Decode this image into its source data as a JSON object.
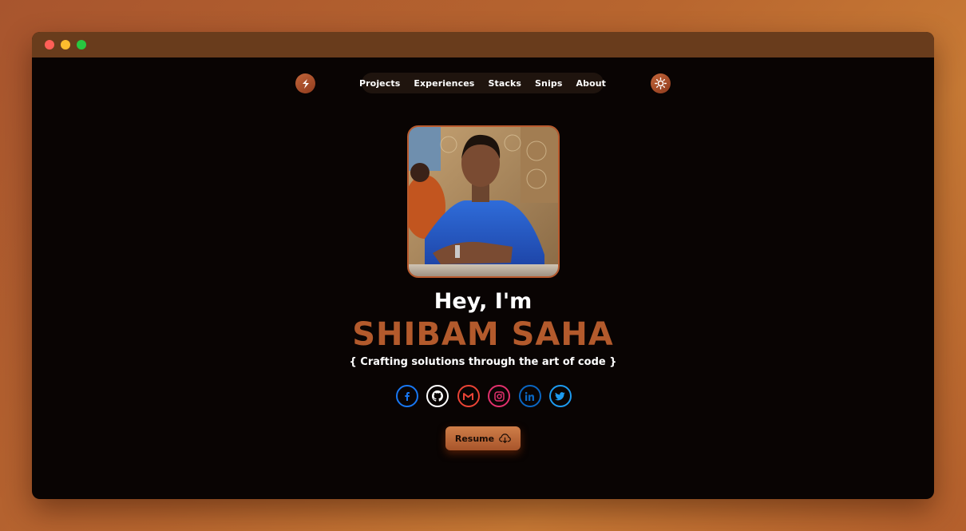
{
  "nav": {
    "items": [
      "Projects",
      "Experiences",
      "Stacks",
      "Snips",
      "About"
    ]
  },
  "hero": {
    "greeting": "Hey, I'm",
    "name": "SHIBAM SAHA",
    "tagline": "{ Crafting solutions through the art of code }"
  },
  "socials": [
    {
      "name": "facebook-icon",
      "color": "#1877f2"
    },
    {
      "name": "github-icon",
      "color": "#ffffff"
    },
    {
      "name": "gmail-icon",
      "color": "#ea4335"
    },
    {
      "name": "instagram-icon",
      "color": "#e1306c"
    },
    {
      "name": "linkedin-icon",
      "color": "#0a66c2"
    },
    {
      "name": "twitter-icon",
      "color": "#1d9bf0"
    }
  ],
  "resume": {
    "label": "Resume",
    "icon": "cloud-download-icon"
  },
  "colors": {
    "accent": "#b35a2c",
    "background": "#090403",
    "titlebar": "#693c1c"
  }
}
